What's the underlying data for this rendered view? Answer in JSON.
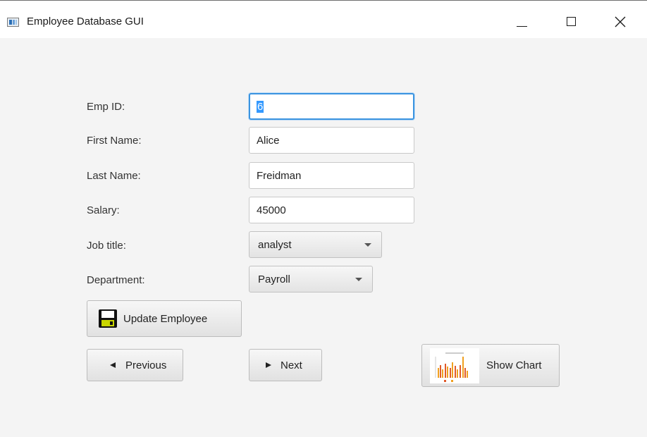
{
  "window": {
    "title": "Employee Database GUI",
    "controls": [
      "minimize-icon",
      "maximize-icon",
      "close-icon"
    ]
  },
  "form": {
    "emp_id": {
      "label": "Emp ID:",
      "value": "6"
    },
    "first_name": {
      "label": "First Name:",
      "value": "Alice"
    },
    "last_name": {
      "label": "Last Name:",
      "value": "Freidman"
    },
    "salary": {
      "label": "Salary:",
      "value": "45000"
    },
    "job_title": {
      "label": "Job title:",
      "selected": "analyst"
    },
    "department": {
      "label": "Department:",
      "selected": "Payroll"
    }
  },
  "buttons": {
    "update": {
      "label": "Update Employee",
      "icon": "floppy-disk-icon"
    },
    "previous": {
      "label": "Previous",
      "icon": "triangle-left-icon"
    },
    "next": {
      "label": "Next",
      "icon": "triangle-right-icon"
    },
    "show_chart": {
      "label": "Show Chart",
      "icon": "bar-chart-thumbnail-icon"
    }
  },
  "colors": {
    "focus_border": "#3b94e0",
    "selection": "#3399ff",
    "background": "#f4f4f4"
  }
}
